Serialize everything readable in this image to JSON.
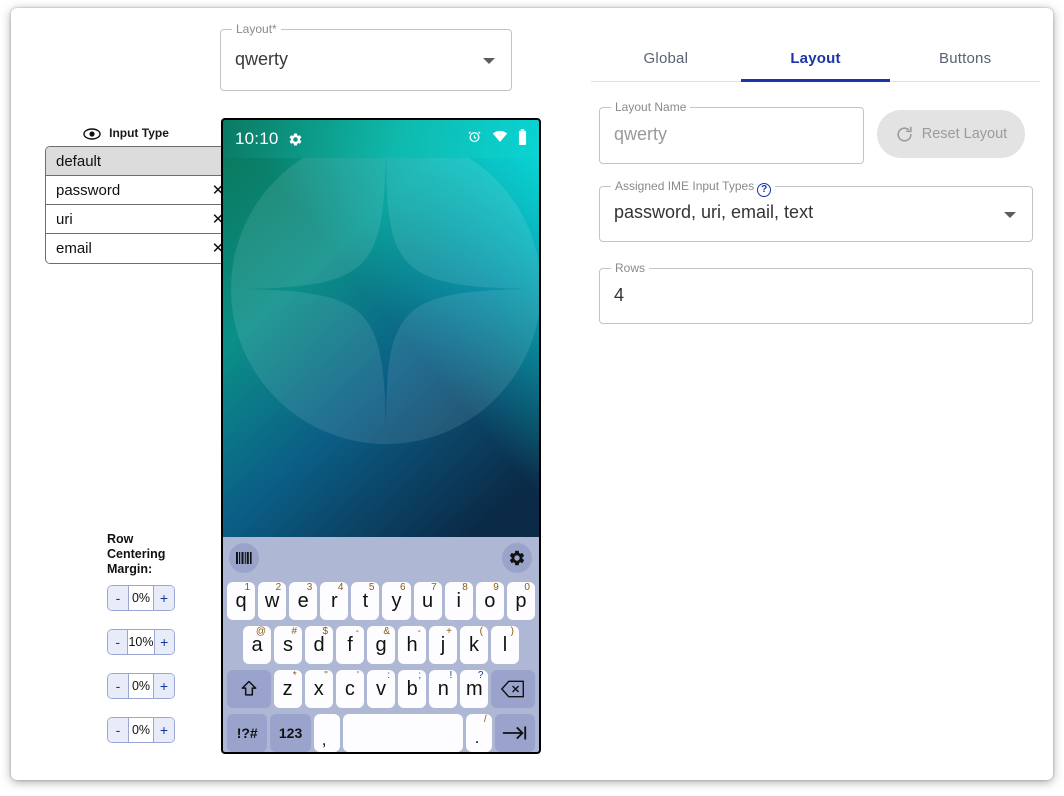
{
  "layout_select": {
    "legend": "Layout*",
    "value": "qwerty",
    "caret_icon": "chevron-down-icon"
  },
  "input_type_panel": {
    "header_label": "Input Type",
    "header_icon": "eye-icon",
    "items": [
      {
        "label": "default",
        "removable": false,
        "selected": true,
        "close_glyph": ""
      },
      {
        "label": "password",
        "removable": true,
        "selected": false,
        "close_glyph": "✕"
      },
      {
        "label": "uri",
        "removable": true,
        "selected": false,
        "close_glyph": "✕"
      },
      {
        "label": "email",
        "removable": true,
        "selected": false,
        "close_glyph": "✕"
      }
    ]
  },
  "row_margins": {
    "title": "Row Centering Margin:",
    "minus_label": "-",
    "plus_label": "+",
    "values": [
      "0%",
      "10%",
      "0%",
      "0%"
    ]
  },
  "phone": {
    "status_bar": {
      "time": "10:10",
      "left_icon": "gear-icon",
      "right_icons": [
        "alarm-icon",
        "wifi-icon",
        "battery-icon"
      ]
    },
    "wallpaper": {
      "gradient_top_left": "#0a7a5f",
      "gradient_top_right": "#0ad4d4",
      "gradient_bottom": "#0b2a47",
      "shape": "circle-with-four-point-star"
    }
  },
  "keyboard": {
    "toolbar": {
      "left_button_icon": "barcode-icon",
      "right_button_icon": "gear-icon"
    },
    "rows": [
      {
        "keys": [
          {
            "label": "q",
            "sup": "1",
            "type": "char"
          },
          {
            "label": "w",
            "sup": "2",
            "type": "char"
          },
          {
            "label": "e",
            "sup": "3",
            "type": "char"
          },
          {
            "label": "r",
            "sup": "4",
            "type": "char"
          },
          {
            "label": "t",
            "sup": "5",
            "type": "char"
          },
          {
            "label": "y",
            "sup": "6",
            "type": "char"
          },
          {
            "label": "u",
            "sup": "7",
            "type": "char"
          },
          {
            "label": "i",
            "sup": "8",
            "type": "char"
          },
          {
            "label": "o",
            "sup": "9",
            "type": "char"
          },
          {
            "label": "p",
            "sup": "0",
            "type": "char"
          }
        ]
      },
      {
        "keys": [
          {
            "label": "a",
            "sup": "@",
            "type": "char"
          },
          {
            "label": "s",
            "sup": "#",
            "type": "char"
          },
          {
            "label": "d",
            "sup": "$",
            "type": "char"
          },
          {
            "label": "f",
            "sup": "-",
            "type": "char"
          },
          {
            "label": "g",
            "sup": "&",
            "type": "char"
          },
          {
            "label": "h",
            "sup": "-",
            "type": "char"
          },
          {
            "label": "j",
            "sup": "+",
            "type": "char"
          },
          {
            "label": "k",
            "sup": "(",
            "type": "char"
          },
          {
            "label": "l",
            "sup": ")",
            "type": "char"
          }
        ]
      },
      {
        "keys": [
          {
            "label": "⇧",
            "sup": "",
            "type": "modifier",
            "name": "shift-key",
            "width": "wide2"
          },
          {
            "label": "z",
            "sup": "*",
            "type": "char"
          },
          {
            "label": "x",
            "sup": "\"",
            "type": "char"
          },
          {
            "label": "c",
            "sup": "'",
            "type": "char"
          },
          {
            "label": "v",
            "sup": ":",
            "type": "char"
          },
          {
            "label": "b",
            "sup": ";",
            "type": "char"
          },
          {
            "label": "n",
            "sup": "!",
            "type": "char"
          },
          {
            "label": "m",
            "sup": "?",
            "type": "char"
          },
          {
            "label": "⌫",
            "sup": "",
            "type": "modifier",
            "name": "backspace-key",
            "width": "wide2"
          }
        ]
      },
      {
        "keys": [
          {
            "label": "!?#",
            "sup": "",
            "type": "modifier",
            "name": "symbols-key",
            "width": "wide2",
            "small": true
          },
          {
            "label": "123",
            "sup": "",
            "type": "modifier",
            "name": "numbers-key",
            "width": "wide2",
            "small": true
          },
          {
            "label": ",",
            "sup": "",
            "type": "char",
            "name": "comma-key"
          },
          {
            "label": "",
            "sup": "",
            "type": "char",
            "name": "space-key",
            "width": "space"
          },
          {
            "label": ".",
            "sup": "/",
            "type": "char",
            "name": "period-key"
          },
          {
            "label": "→|",
            "sup": "",
            "type": "modifier",
            "name": "enter-key",
            "width": "wide2"
          }
        ]
      }
    ]
  },
  "right_panel": {
    "tabs": [
      {
        "label": "Global",
        "active": false
      },
      {
        "label": "Layout",
        "active": true
      },
      {
        "label": "Buttons",
        "active": false
      }
    ],
    "layout_name": {
      "legend": "Layout Name",
      "value": "qwerty"
    },
    "reset_layout": {
      "label": "Reset Layout",
      "icon": "refresh-icon"
    },
    "ime_input_types": {
      "legend": "Assigned IME Input Types",
      "help_glyph": "?",
      "value": "password, uri, email, text",
      "caret_icon": "chevron-down-icon"
    },
    "rows": {
      "legend": "Rows",
      "value": "4"
    }
  },
  "colors": {
    "accent": "#1a35a8",
    "keyboard_bg": "#aeb7d4",
    "key_bg": "#fdfdff",
    "modifier_key_bg": "#99a3cc",
    "selected_row_bg": "#dcdcdc"
  }
}
